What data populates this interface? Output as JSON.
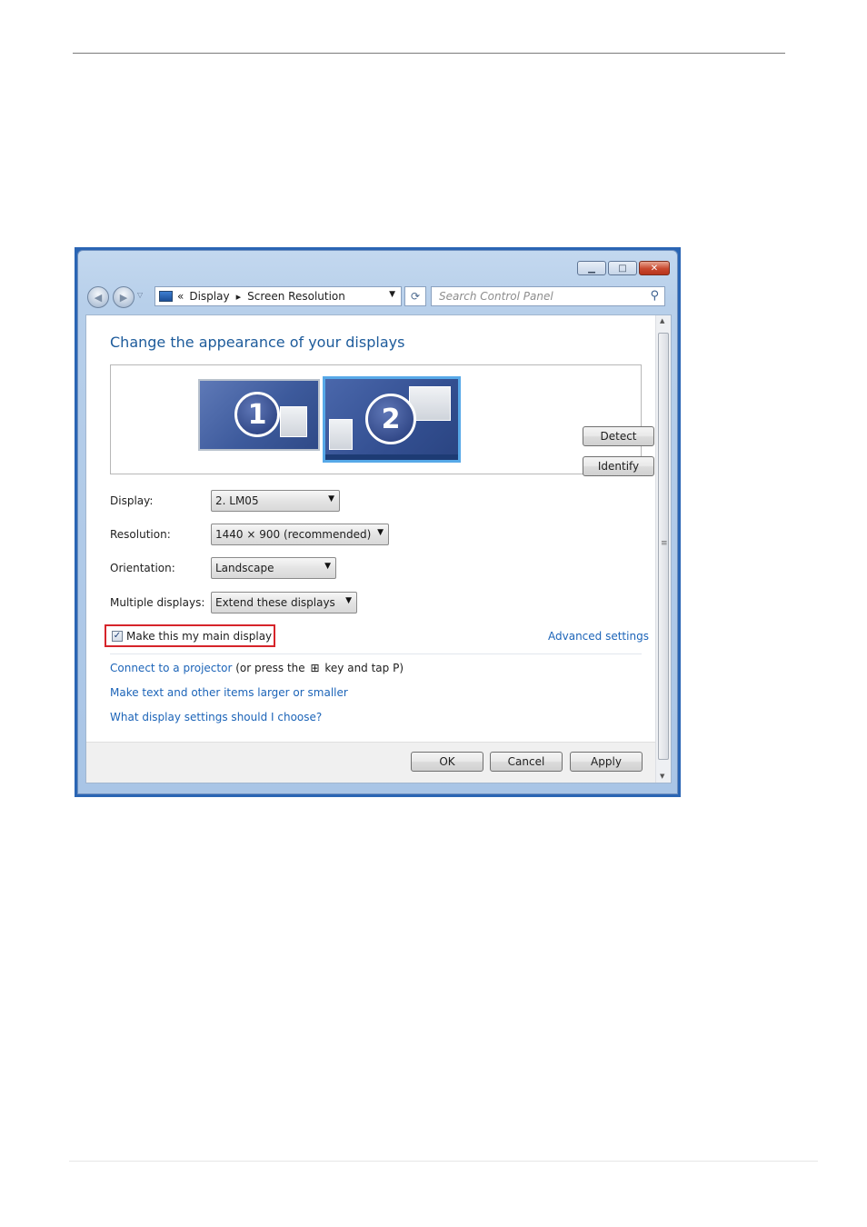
{
  "nav": {
    "address_prefix": "«",
    "breadcrumb": [
      "Display",
      "Screen Resolution"
    ],
    "search_placeholder": "Search Control Panel"
  },
  "content": {
    "heading": "Change the appearance of your displays",
    "monitors": [
      {
        "number": "1"
      },
      {
        "number": "2"
      }
    ],
    "detect_button": "Detect",
    "identify_button": "Identify",
    "settings": {
      "display": {
        "label": "Display:",
        "value": "2. LM05"
      },
      "resolution": {
        "label": "Resolution:",
        "value": "1440 × 900 (recommended)"
      },
      "orientation": {
        "label": "Orientation:",
        "value": "Landscape"
      },
      "multiple": {
        "label": "Multiple displays:",
        "value": "Extend these displays"
      }
    },
    "main_display_checkbox": {
      "label": "Make this my main display",
      "checked": true
    },
    "advanced_link": "Advanced settings",
    "projector_link": "Connect to a projector",
    "projector_hint_pre": "(or press the",
    "projector_hint_post": "key and tap P)",
    "text_size_link": "Make text and other items larger or smaller",
    "help_link": "What display settings should I choose?"
  },
  "footer": {
    "ok": "OK",
    "cancel": "Cancel",
    "apply": "Apply"
  },
  "colors": {
    "heading": "#1d5b9b",
    "link": "#1c64b8",
    "highlight_border": "#d6242a",
    "selected_monitor": "#57a9e8"
  }
}
